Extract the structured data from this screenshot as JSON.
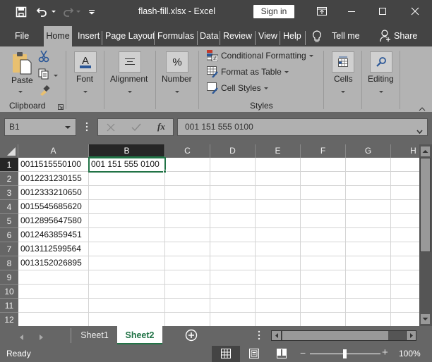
{
  "titlebar": {
    "title": "flash-fill.xlsx  -  Excel",
    "sign_in": "Sign in",
    "icons": [
      "save-icon",
      "undo-icon",
      "redo-icon",
      "customize-qat-icon",
      "ribbon-display-options-icon",
      "minimize-icon",
      "maximize-icon",
      "close-icon"
    ]
  },
  "tabs": [
    {
      "label": "File"
    },
    {
      "label": "Home",
      "active": true
    },
    {
      "label": "Insert"
    },
    {
      "label": "Page Layout"
    },
    {
      "label": "Formulas"
    },
    {
      "label": "Data"
    },
    {
      "label": "Review"
    },
    {
      "label": "View"
    },
    {
      "label": "Help"
    }
  ],
  "tell_me": "Tell me",
  "share": "Share",
  "ribbon": {
    "clipboard": {
      "paste": "Paste",
      "group": "Clipboard"
    },
    "font": "Font",
    "alignment": "Alignment",
    "number": "Number",
    "number_symbol": "%",
    "styles": {
      "conditional_formatting": "Conditional Formatting",
      "format_as_table": "Format as Table",
      "cell_styles": "Cell Styles",
      "group": "Styles"
    },
    "cells": "Cells",
    "editing": "Editing"
  },
  "formula_bar": {
    "name_box": "B1",
    "fx": "fx",
    "formula": "001 151 555 0100"
  },
  "grid": {
    "columns": [
      "A",
      "B",
      "C",
      "D",
      "E",
      "F",
      "G",
      "H"
    ],
    "selected_column": "B",
    "selected_row": 1,
    "rows": [
      {
        "n": "1",
        "A": "0011515550100",
        "B": "001 151 555 0100"
      },
      {
        "n": "2",
        "A": "0012231230155",
        "B": ""
      },
      {
        "n": "3",
        "A": "0012333210650",
        "B": ""
      },
      {
        "n": "4",
        "A": "0015545685620",
        "B": ""
      },
      {
        "n": "5",
        "A": "0012895647580",
        "B": ""
      },
      {
        "n": "6",
        "A": "0012463859451",
        "B": ""
      },
      {
        "n": "7",
        "A": "0013112599564",
        "B": ""
      },
      {
        "n": "8",
        "A": "0013152026895",
        "B": ""
      },
      {
        "n": "9",
        "A": "",
        "B": ""
      },
      {
        "n": "10",
        "A": "",
        "B": ""
      },
      {
        "n": "11",
        "A": "",
        "B": ""
      },
      {
        "n": "12",
        "A": "",
        "B": ""
      }
    ]
  },
  "sheets": [
    {
      "label": "Sheet1",
      "active": false
    },
    {
      "label": "Sheet2",
      "active": true
    }
  ],
  "status": {
    "ready": "Ready",
    "zoom": "100%",
    "zoom_minus": "−",
    "zoom_plus": "+"
  },
  "colors": {
    "accent": "#217346",
    "titlebar_bg": "#444444",
    "ribbon_bg": "#b3b3b3"
  }
}
